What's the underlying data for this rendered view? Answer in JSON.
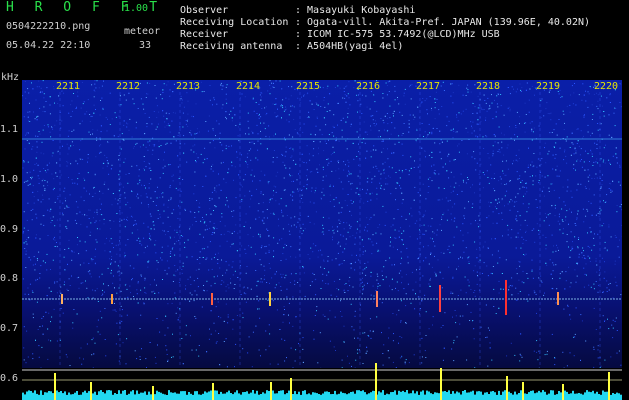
{
  "app": {
    "name": "H R O F F T",
    "version": "1.00",
    "file": "0504222210.png",
    "mode": "meteor",
    "datetime": "05.04.22 22:10",
    "count": "33"
  },
  "station": [
    {
      "key": "Observer",
      "value": ": Masayuki Kobayashi"
    },
    {
      "key": "Receiving Location",
      "value": ": Ogata-vill. Akita-Pref. JAPAN (139.96E, 40.02N)"
    },
    {
      "key": "Receiver",
      "value": ": ICOM IC-575 53.7492(@LCD)MHz USB"
    },
    {
      "key": "Receiving antenna",
      "value": ": A504HB(yagi 4el)"
    }
  ],
  "y_axis": {
    "unit": "kHz",
    "ticks": [
      "1.1",
      "1.0",
      "0.9",
      "0.8",
      "0.7",
      "0.6"
    ]
  },
  "time_axis": {
    "ticks": [
      "2211",
      "2212",
      "2213",
      "2214",
      "2215",
      "2216",
      "2217",
      "2218",
      "2219",
      "2220"
    ]
  },
  "colors": {
    "title_green": "#29e04a",
    "time_yellow": "#e6e600",
    "background": "#000000",
    "spec_blue": "#0a1fa8",
    "count_cyan": "#22d8f0",
    "echo_yellow": "#ffff40"
  }
}
